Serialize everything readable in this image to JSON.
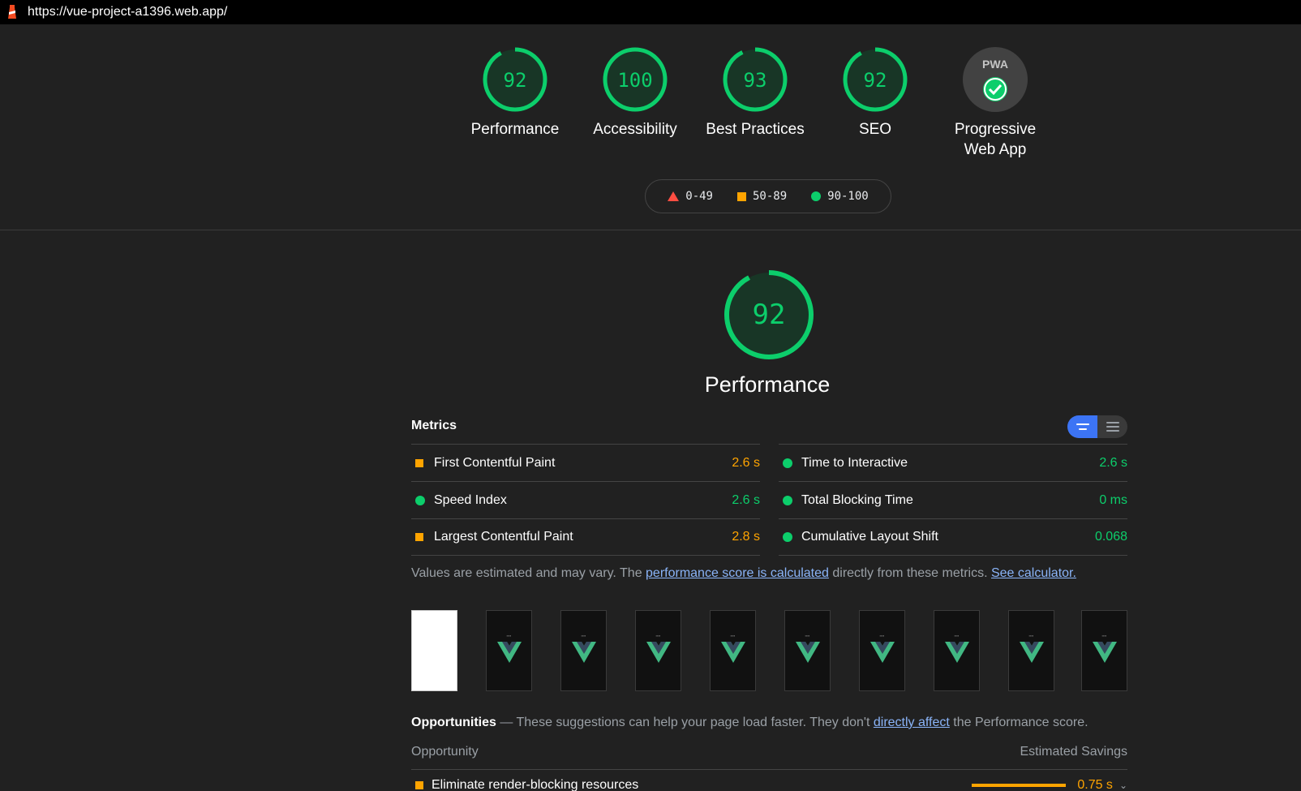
{
  "url": "https://vue-project-a1396.web.app/",
  "colors": {
    "pass": "#0cce6b",
    "average": "#ffa400",
    "fail": "#ff4e42",
    "link": "#8ab4f8"
  },
  "gauges": [
    {
      "label": "Performance",
      "score": "92"
    },
    {
      "label": "Accessibility",
      "score": "100"
    },
    {
      "label": "Best Practices",
      "score": "93"
    },
    {
      "label": "SEO",
      "score": "92"
    },
    {
      "label": "Progressive\nWeb App",
      "badge": "PWA",
      "icon": "pwa-check-icon"
    }
  ],
  "legend": [
    {
      "shape": "triangle",
      "range": "0-49"
    },
    {
      "shape": "square",
      "range": "50-89"
    },
    {
      "shape": "circle",
      "range": "90-100"
    }
  ],
  "performance": {
    "score": "92",
    "title": "Performance"
  },
  "metrics": {
    "heading": "Metrics",
    "left": [
      {
        "name": "First Contentful Paint",
        "value": "2.6 s",
        "rating": "average"
      },
      {
        "name": "Speed Index",
        "value": "2.6 s",
        "rating": "pass"
      },
      {
        "name": "Largest Contentful Paint",
        "value": "2.8 s",
        "rating": "average"
      }
    ],
    "right": [
      {
        "name": "Time to Interactive",
        "value": "2.6 s",
        "rating": "pass"
      },
      {
        "name": "Total Blocking Time",
        "value": "0 ms",
        "rating": "pass"
      },
      {
        "name": "Cumulative Layout Shift",
        "value": "0.068",
        "rating": "pass"
      }
    ]
  },
  "note": {
    "pre": "Values are estimated and may vary. The ",
    "link1": "performance score is calculated",
    "mid": " directly from these metrics. ",
    "link2": "See calculator."
  },
  "filmstrip_frames": 10,
  "opportunities": {
    "heading": "Opportunities",
    "desc_pre": " — These suggestions can help your page load faster. They don't ",
    "desc_link": "directly affect",
    "desc_post": " the Performance score.",
    "col_left": "Opportunity",
    "col_right": "Estimated Savings",
    "items": [
      {
        "name": "Eliminate render-blocking resources",
        "value": "0.75 s",
        "rating": "average"
      }
    ]
  }
}
